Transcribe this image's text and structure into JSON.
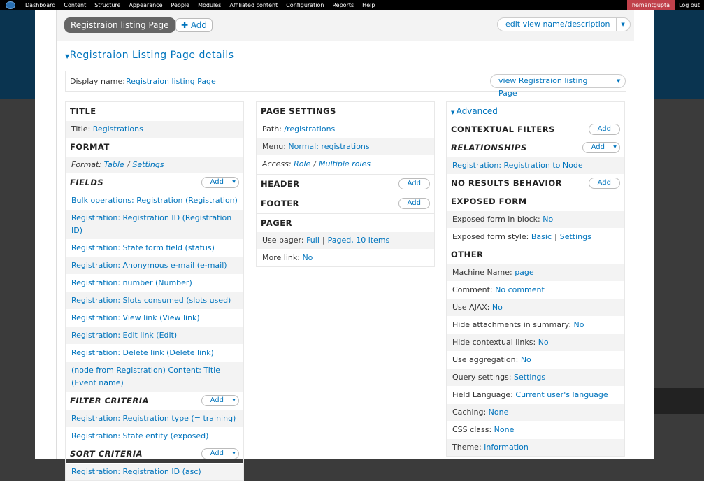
{
  "toolbar": {
    "items": [
      "Dashboard",
      "Content",
      "Structure",
      "Appearance",
      "People",
      "Modules",
      "Affiliated content",
      "Configuration",
      "Reports",
      "Help"
    ],
    "user": "hemantgupta",
    "logout": "Log out"
  },
  "top": {
    "active_tab": "Registraion listing Page",
    "add_label": "Add",
    "edit_label": "edit view name/description"
  },
  "details": {
    "title": "Registraion Listing Page details",
    "display_name_label": "Display name:",
    "display_name_value": "Registraion listing Page",
    "view_button": "view Registraion listing Page"
  },
  "left": {
    "title_h": "TITLE",
    "title_label": "Title:",
    "title_value": "Registrations",
    "format_h": "FORMAT",
    "format_label": "Format:",
    "format_value": "Table",
    "format_settings": "Settings",
    "fields_h": "FIELDS",
    "fields": [
      "Bulk operations: Registration (Registration)",
      "Registration: Registration ID (Registration ID)",
      "Registration: State form field (status)",
      "Registration: Anonymous e-mail (e-mail)",
      "Registration: number (Number)",
      "Registration: Slots consumed (slots used)",
      "Registration: View link (View link)",
      "Registration: Edit link (Edit)",
      "Registration: Delete link (Delete link)",
      "(node from Registration) Content: Title (Event name)"
    ],
    "filter_h": "FILTER CRITERIA",
    "filters": [
      "Registration: Registration type (= training)",
      "Registration: State entity (exposed)"
    ],
    "sort_h": "SORT CRITERIA",
    "sorts": [
      "Registration: Registration ID (asc)"
    ]
  },
  "middle": {
    "page_settings_h": "PAGE SETTINGS",
    "path_label": "Path:",
    "path_value": "/registrations",
    "menu_label": "Menu:",
    "menu_value": "Normal: registrations",
    "access_label": "Access:",
    "access_value": "Role",
    "access_value2": "Multiple roles",
    "header_h": "HEADER",
    "footer_h": "FOOTER",
    "pager_h": "PAGER",
    "use_pager_label": "Use pager:",
    "use_pager_value": "Full",
    "use_pager_value2": "Paged, 10 items",
    "more_link_label": "More link:",
    "more_link_value": "No"
  },
  "right": {
    "advanced": "Advanced",
    "contextual_h": "CONTEXTUAL FILTERS",
    "relationships_h": "RELATIONSHIPS",
    "relationship_item": "Registration: Registration to Node",
    "no_results_h": "NO RESULTS BEHAVIOR",
    "exposed_h": "EXPOSED FORM",
    "exposed_block_label": "Exposed form in block:",
    "exposed_block_value": "No",
    "exposed_style_label": "Exposed form style:",
    "exposed_style_value": "Basic",
    "exposed_style_settings": "Settings",
    "other_h": "OTHER",
    "other": [
      {
        "label": "Machine Name:",
        "value": "page"
      },
      {
        "label": "Comment:",
        "value": "No comment"
      },
      {
        "label": "Use AJAX:",
        "value": "No"
      },
      {
        "label": "Hide attachments in summary:",
        "value": "No"
      },
      {
        "label": "Hide contextual links:",
        "value": "No"
      },
      {
        "label": "Use aggregation:",
        "value": "No"
      },
      {
        "label": "Query settings:",
        "value": "Settings"
      },
      {
        "label": "Field Language:",
        "value": "Current user's language"
      },
      {
        "label": "Caching:",
        "value": "None"
      },
      {
        "label": "CSS class:",
        "value": "None"
      },
      {
        "label": "Theme:",
        "value": "Information"
      }
    ]
  },
  "buttons": {
    "add": "Add"
  }
}
